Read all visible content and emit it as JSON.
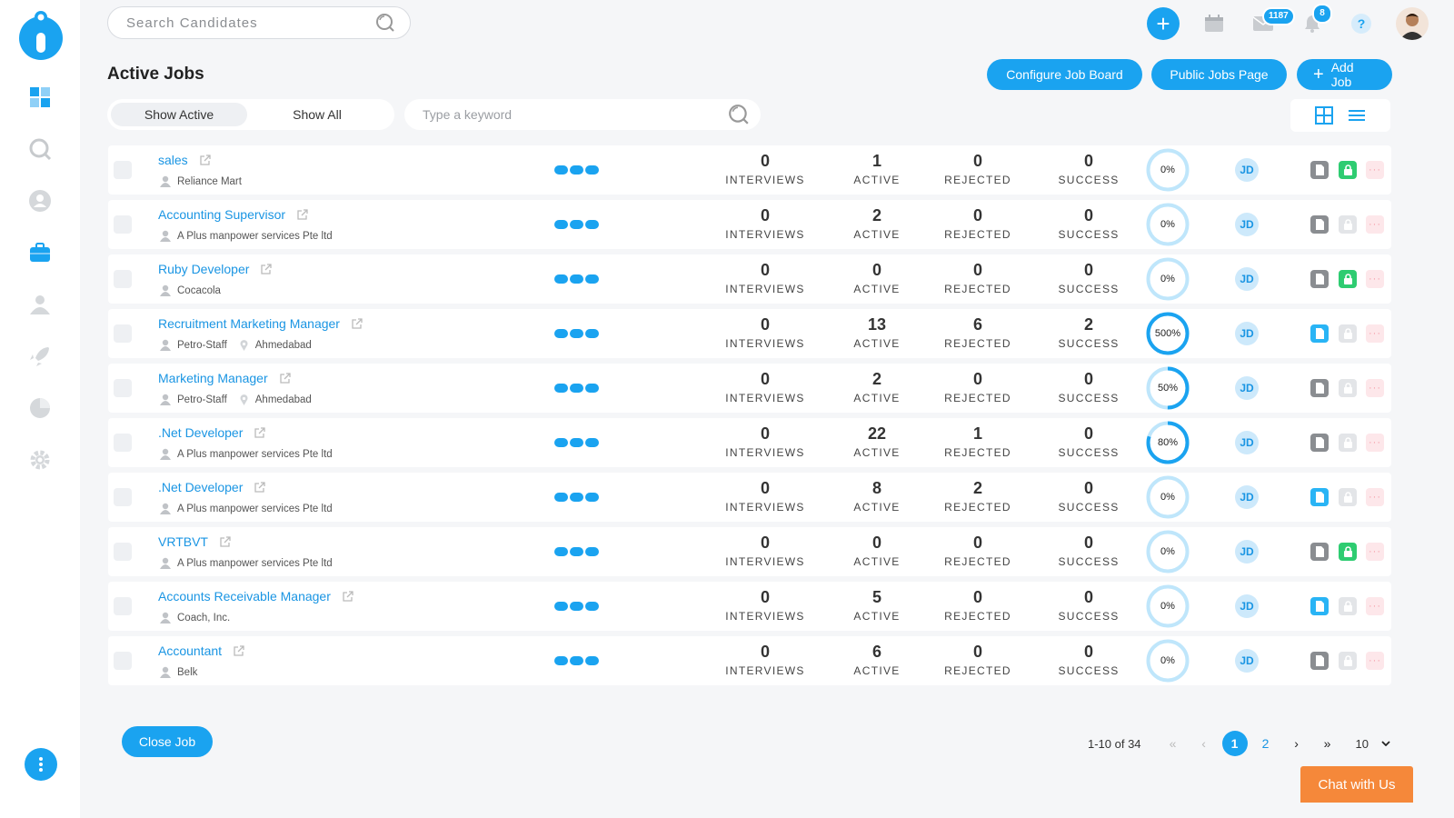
{
  "header": {
    "search_placeholder": "Search Candidates",
    "mail_badge": "1187",
    "notification_badge": "8",
    "help": "?"
  },
  "page": {
    "title": "Active Jobs",
    "configure_button": "Configure Job Board",
    "public_button": "Public Jobs Page",
    "add_job_button": "Add Job"
  },
  "filters": {
    "show_active": "Show Active",
    "show_all": "Show All",
    "keyword_placeholder": "Type a keyword"
  },
  "labels": {
    "interviews": "INTERVIEWS",
    "active": "ACTIVE",
    "rejected": "REJECTED",
    "success": "SUCCESS",
    "jd": "JD",
    "more": "···"
  },
  "jobs": [
    {
      "title": "sales",
      "company": "Reliance Mart",
      "location": "",
      "interviews": "0",
      "active": "1",
      "rejected": "0",
      "success": "0",
      "ratio": "0%",
      "ratio_fraction": 0,
      "doc_style": "gray",
      "lock_style": "green"
    },
    {
      "title": "Accounting Supervisor",
      "company": "A Plus manpower services Pte ltd",
      "location": "",
      "interviews": "0",
      "active": "2",
      "rejected": "0",
      "success": "0",
      "ratio": "0%",
      "ratio_fraction": 0,
      "doc_style": "gray",
      "lock_style": "gray"
    },
    {
      "title": "Ruby Developer",
      "company": "Cocacola",
      "location": "",
      "interviews": "0",
      "active": "0",
      "rejected": "0",
      "success": "0",
      "ratio": "0%",
      "ratio_fraction": 0,
      "doc_style": "gray",
      "lock_style": "green"
    },
    {
      "title": "Recruitment Marketing Manager",
      "company": "Petro-Staff",
      "location": "Ahmedabad",
      "interviews": "0",
      "active": "13",
      "rejected": "6",
      "success": "2",
      "ratio": "500%",
      "ratio_fraction": 1,
      "doc_style": "blue",
      "lock_style": "gray"
    },
    {
      "title": "Marketing Manager",
      "company": "Petro-Staff",
      "location": "Ahmedabad",
      "interviews": "0",
      "active": "2",
      "rejected": "0",
      "success": "0",
      "ratio": "50%",
      "ratio_fraction": 0.5,
      "doc_style": "gray",
      "lock_style": "gray"
    },
    {
      "title": ".Net Developer",
      "company": "A Plus manpower services Pte ltd",
      "location": "",
      "interviews": "0",
      "active": "22",
      "rejected": "1",
      "success": "0",
      "ratio": "80%",
      "ratio_fraction": 0.8,
      "doc_style": "gray",
      "lock_style": "gray"
    },
    {
      "title": ".Net Developer",
      "company": "A Plus manpower services Pte ltd",
      "location": "",
      "interviews": "0",
      "active": "8",
      "rejected": "2",
      "success": "0",
      "ratio": "0%",
      "ratio_fraction": 0,
      "doc_style": "blue",
      "lock_style": "gray"
    },
    {
      "title": "VRTBVT",
      "company": "A Plus manpower services Pte ltd",
      "location": "",
      "interviews": "0",
      "active": "0",
      "rejected": "0",
      "success": "0",
      "ratio": "0%",
      "ratio_fraction": 0,
      "doc_style": "gray",
      "lock_style": "green"
    },
    {
      "title": "Accounts Receivable Manager",
      "company": "Coach, Inc.",
      "location": "",
      "interviews": "0",
      "active": "5",
      "rejected": "0",
      "success": "0",
      "ratio": "0%",
      "ratio_fraction": 0,
      "doc_style": "blue",
      "lock_style": "gray"
    },
    {
      "title": "Accountant",
      "company": "Belk",
      "location": "",
      "interviews": "0",
      "active": "6",
      "rejected": "0",
      "success": "0",
      "ratio": "0%",
      "ratio_fraction": 0,
      "doc_style": "gray",
      "lock_style": "gray"
    }
  ],
  "footer": {
    "close_job": "Close Job",
    "range": "1-10 of 34",
    "first": "«",
    "prev": "‹",
    "next": "›",
    "last": "»",
    "pages": [
      "1",
      "2"
    ],
    "current_page": "1",
    "page_size": "10",
    "chat": "Chat with Us"
  },
  "colors": {
    "accent": "#1aa3f0",
    "ring_track": "#bfe6fb",
    "chat": "#f5883a",
    "lock_green": "#2ecc71"
  }
}
